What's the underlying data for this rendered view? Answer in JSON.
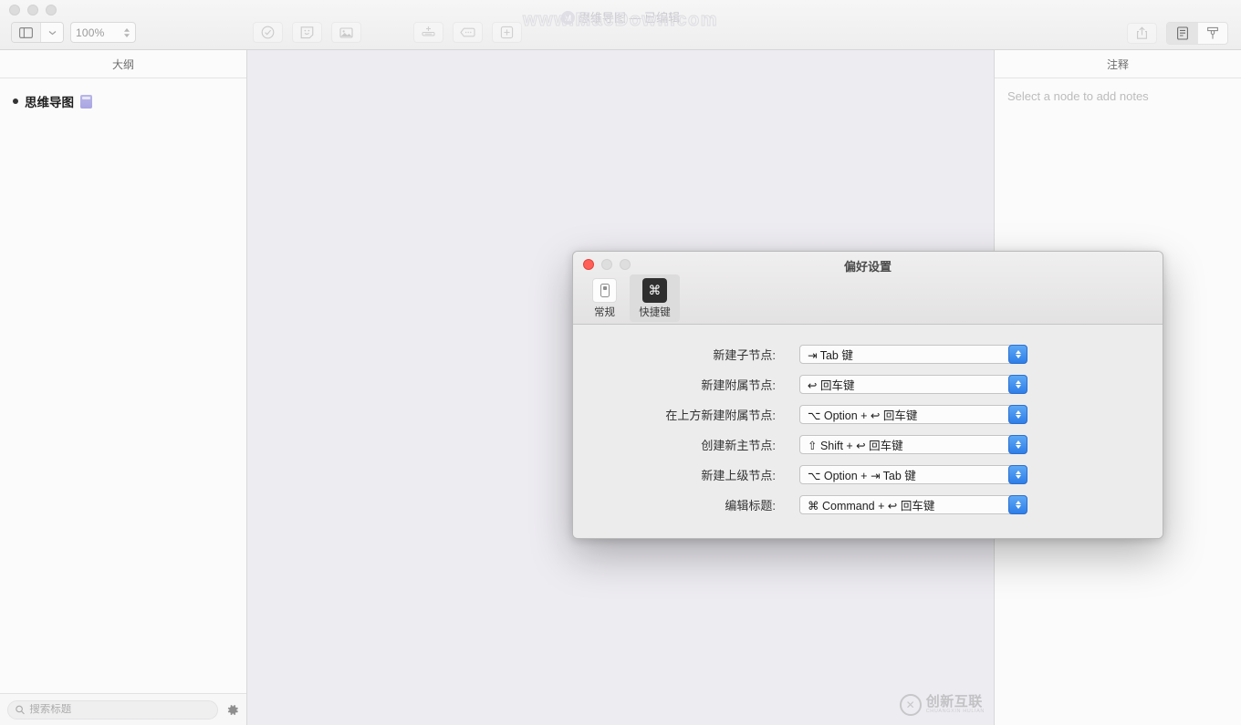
{
  "window": {
    "title": "思维导图 — 已编辑",
    "watermark_top": "www.MacDown.com",
    "zoom_value": "100%"
  },
  "toolbar": {
    "sidebar_toggle": "sidebar-toggle",
    "icons": {
      "check": "check-circle-icon",
      "sticker": "sticker-icon",
      "image": "image-icon",
      "add_node": "add-node-icon",
      "comment": "comment-icon",
      "plus": "plus-box-icon",
      "share": "share-icon",
      "notes": "notes-icon",
      "format": "format-brush-icon"
    }
  },
  "sidebar": {
    "header": "大纲",
    "items": [
      {
        "label": "思维导图",
        "emoji": "node-emoji"
      }
    ],
    "search": {
      "placeholder": "搜索标题",
      "value": ""
    },
    "settings_icon": "gear-icon"
  },
  "notes_panel": {
    "header": "注释",
    "placeholder": "Select a node to add notes"
  },
  "dialog": {
    "title": "偏好设置",
    "tabs": [
      {
        "label": "常规",
        "icon": "switch-panel-icon",
        "active": false
      },
      {
        "label": "快捷键",
        "icon": "command-key-icon",
        "active": true
      }
    ],
    "rows": [
      {
        "label": "新建子节点:",
        "symbol": "⇥",
        "value": "Tab 键",
        "full": "⇥ Tab 键"
      },
      {
        "label": "新建附属节点:",
        "symbol": "↩",
        "value": "回车键",
        "full": "↩ 回车键"
      },
      {
        "label": "在上方新建附属节点:",
        "symbol": "⌥",
        "value": "Option + ↩ 回车键",
        "full": "⌥ Option + ↩ 回车键"
      },
      {
        "label": "创建新主节点:",
        "symbol": "⇧",
        "value": "Shift + ↩ 回车键",
        "full": "⇧ Shift + ↩ 回车键"
      },
      {
        "label": "新建上级节点:",
        "symbol": "⌥",
        "value": "Option + ⇥ Tab 键",
        "full": "⌥ Option + ⇥ Tab 键"
      },
      {
        "label": "编辑标题:",
        "symbol": "⌘",
        "value": "Command + ↩ 回车键",
        "full": "⌘ Command + ↩ 回车键"
      }
    ]
  },
  "watermark_bottom": {
    "cn": "创新互联",
    "en": "CHUANGXIN HULIAN"
  },
  "colors": {
    "accent_blue": "#2e7ee8",
    "canvas": "#edecf1",
    "dialog_bg": "#ececec",
    "close_red": "#ff5f57"
  }
}
